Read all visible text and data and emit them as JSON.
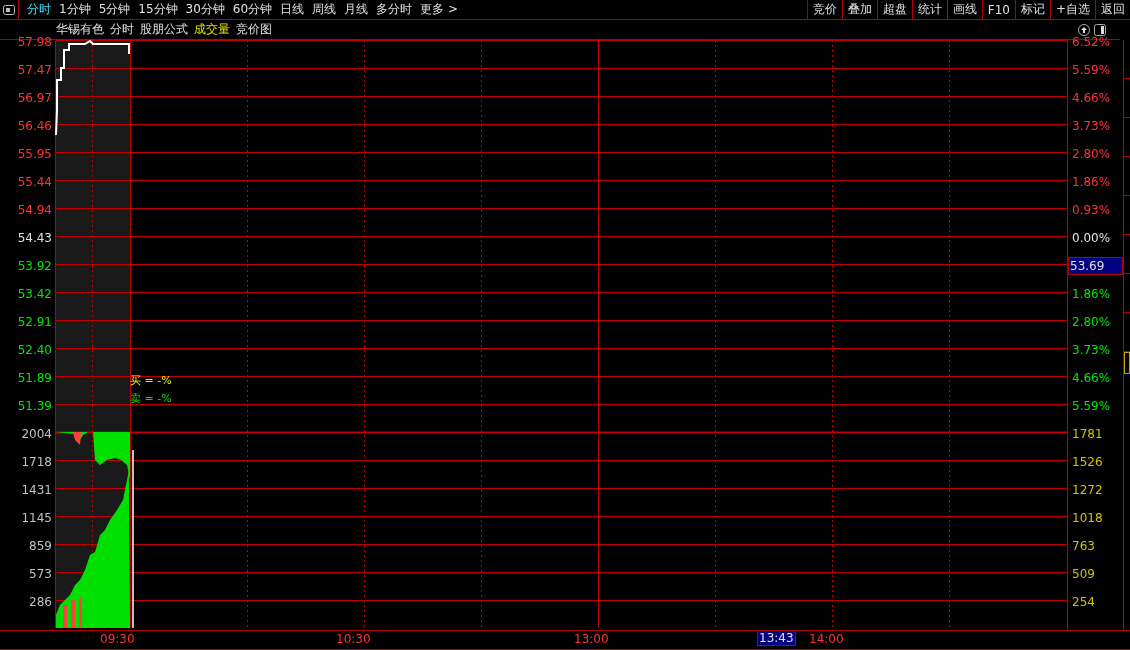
{
  "toolbar": {
    "left_tabs": [
      {
        "label": "分时",
        "selected": true
      },
      {
        "label": "1分钟",
        "selected": false
      },
      {
        "label": "5分钟",
        "selected": false
      },
      {
        "label": "15分钟",
        "selected": false
      },
      {
        "label": "30分钟",
        "selected": false
      },
      {
        "label": "60分钟",
        "selected": false
      },
      {
        "label": "日线",
        "selected": false
      },
      {
        "label": "周线",
        "selected": false
      },
      {
        "label": "月线",
        "selected": false
      },
      {
        "label": "多分时",
        "selected": false
      },
      {
        "label": "更多 >",
        "selected": false
      }
    ],
    "right_buttons": [
      "竞价",
      "叠加",
      "超盘",
      "统计",
      "画线",
      "F10",
      "标记",
      "+自选",
      "返回"
    ]
  },
  "chart_header": {
    "stock_name": "华锡有色",
    "items": [
      {
        "label": "分时",
        "highlighted": false
      },
      {
        "label": "股朋公式",
        "highlighted": false
      },
      {
        "label": "成交量",
        "highlighted": true
      },
      {
        "label": "竞价图",
        "highlighted": false
      }
    ]
  },
  "left_axis": [
    {
      "text": "57.98",
      "kind": "up"
    },
    {
      "text": "57.47",
      "kind": "up"
    },
    {
      "text": "56.97",
      "kind": "up"
    },
    {
      "text": "56.46",
      "kind": "up"
    },
    {
      "text": "55.95",
      "kind": "up"
    },
    {
      "text": "55.44",
      "kind": "up"
    },
    {
      "text": "54.94",
      "kind": "up"
    },
    {
      "text": "54.43",
      "kind": "flat"
    },
    {
      "text": "53.92",
      "kind": "down"
    },
    {
      "text": "53.42",
      "kind": "down"
    },
    {
      "text": "52.91",
      "kind": "down"
    },
    {
      "text": "52.40",
      "kind": "down"
    },
    {
      "text": "51.89",
      "kind": "down"
    },
    {
      "text": "51.39",
      "kind": "down"
    },
    {
      "text": "2004",
      "kind": "volume"
    },
    {
      "text": "1718",
      "kind": "volume"
    },
    {
      "text": "1431",
      "kind": "volume"
    },
    {
      "text": "1145",
      "kind": "volume"
    },
    {
      "text": "859",
      "kind": "volume"
    },
    {
      "text": "573",
      "kind": "volume"
    },
    {
      "text": "286",
      "kind": "volume"
    }
  ],
  "right_axis": [
    {
      "text": "6.52%",
      "kind": "up"
    },
    {
      "text": "5.59%",
      "kind": "up"
    },
    {
      "text": "4.66%",
      "kind": "up"
    },
    {
      "text": "3.73%",
      "kind": "up"
    },
    {
      "text": "2.80%",
      "kind": "up"
    },
    {
      "text": "1.86%",
      "kind": "up"
    },
    {
      "text": "0.93%",
      "kind": "up"
    },
    {
      "text": "0.00%",
      "kind": "flat"
    },
    {
      "text": "53.69",
      "kind": "cursor"
    },
    {
      "text": "1.86%",
      "kind": "down"
    },
    {
      "text": "2.80%",
      "kind": "down"
    },
    {
      "text": "3.73%",
      "kind": "down"
    },
    {
      "text": "4.66%",
      "kind": "down"
    },
    {
      "text": "5.59%",
      "kind": "down"
    },
    {
      "text": "1781",
      "kind": "volume"
    },
    {
      "text": "1526",
      "kind": "volume"
    },
    {
      "text": "1272",
      "kind": "volume"
    },
    {
      "text": "1018",
      "kind": "volume"
    },
    {
      "text": "763",
      "kind": "volume"
    },
    {
      "text": "509",
      "kind": "volume"
    },
    {
      "text": "254",
      "kind": "volume"
    }
  ],
  "order_ratio": [
    {
      "text": "买 = -%",
      "kind": "buy"
    },
    {
      "text": "卖 = -%",
      "kind": "sell"
    }
  ],
  "time_axis": [
    {
      "text": "09:30",
      "kind": "tick"
    },
    {
      "text": "10:30",
      "kind": "tick"
    },
    {
      "text": "13:00",
      "kind": "tick"
    },
    {
      "text": "13:43",
      "kind": "cursor"
    },
    {
      "text": "14:00",
      "kind": "tick"
    }
  ]
}
